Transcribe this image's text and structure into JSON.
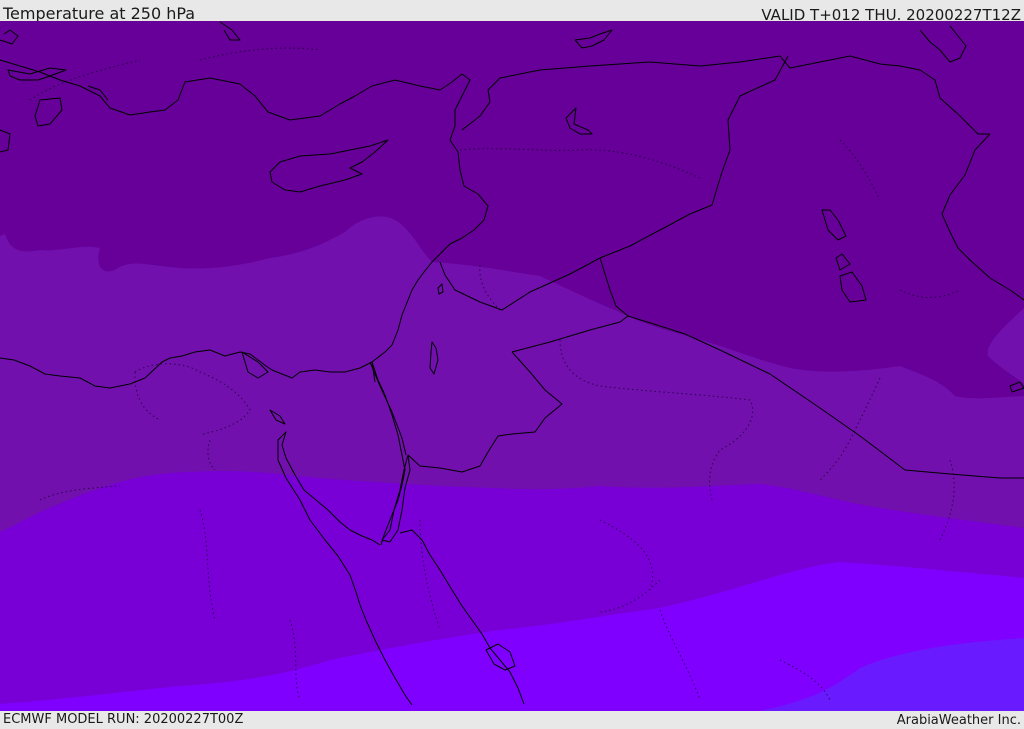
{
  "header": {
    "title": "Temperature at 250 hPa",
    "valid_time": "VALID T+012 THU. 20200227T12Z"
  },
  "footer": {
    "model_run": "ECMWF MODEL RUN: 20200227T00Z",
    "credit": "ArabiaWeather Inc."
  },
  "map": {
    "variable": "temperature",
    "level": "250 hPa",
    "colors": {
      "band_1": "#660099",
      "band_2": "#7110ad",
      "band_3": "#7800d6",
      "band_4": "#8000ff",
      "band_5": "#6a1aff",
      "coastline": "#000000",
      "border": "#000000"
    }
  }
}
